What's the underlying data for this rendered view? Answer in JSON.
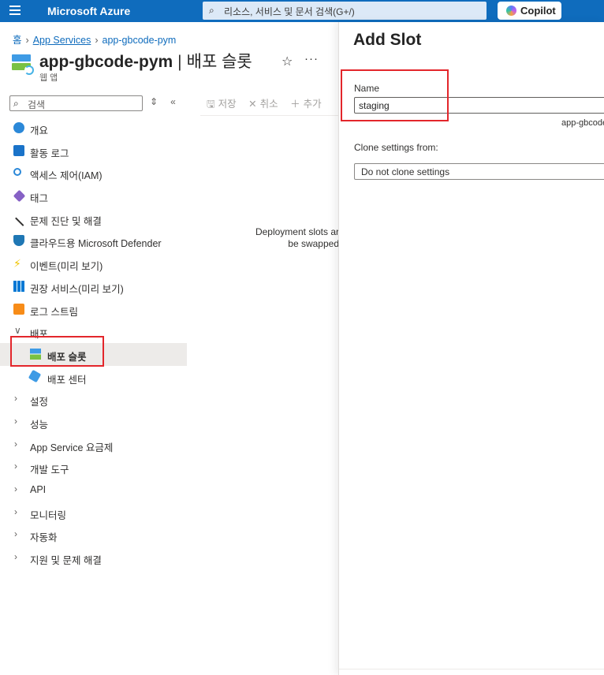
{
  "topbar": {
    "brand": "Microsoft Azure",
    "search_placeholder": "리소스, 서비스 및 문서 검색(G+/)",
    "copilot_label": "Copilot",
    "accent_color": "#0f6cbd"
  },
  "breadcrumb": {
    "home": "홈",
    "app_services": "App Services",
    "resource": "app-gbcode-pym"
  },
  "resource": {
    "name": "app-gbcode-pym",
    "page": "배포 슬롯",
    "type": "웹 앱"
  },
  "menu": {
    "search_placeholder": "검색",
    "items": [
      {
        "label": "개요",
        "icon": "overview-icon"
      },
      {
        "label": "활동 로그",
        "icon": "activity-log-icon"
      },
      {
        "label": "액세스 제어(IAM)",
        "icon": "iam-icon"
      },
      {
        "label": "태그",
        "icon": "tag-icon"
      },
      {
        "label": "문제 진단 및 해결",
        "icon": "wrench-icon"
      },
      {
        "label": "클라우드용 Microsoft Defender",
        "icon": "defender-shield-icon"
      },
      {
        "label": "이벤트(미리 보기)",
        "icon": "lightning-icon"
      },
      {
        "label": "권장 서비스(미리 보기)",
        "icon": "grid-icon"
      },
      {
        "label": "로그 스트림",
        "icon": "log-stream-icon"
      }
    ],
    "deploy_group": "배포",
    "deploy_children": [
      {
        "label": "배포 슬롯",
        "icon": "deployment-slot-icon"
      },
      {
        "label": "배포 센터",
        "icon": "cube-icon"
      }
    ],
    "groups": [
      "설정",
      "성능",
      "App Service 요금제",
      "개발 도구",
      "API",
      "모니터링",
      "자동화",
      "지원 및 문제 해결"
    ]
  },
  "toolbar": {
    "save": "저장",
    "cancel": "취소",
    "add": "추가"
  },
  "empty_message": {
    "line1": "Deployment slots ar",
    "line2": "be swapped"
  },
  "panel": {
    "title": "Add Slot",
    "name_label": "Name",
    "name_value": "staging",
    "name_suffix": "app-gbcode",
    "clone_label": "Clone settings from:",
    "clone_value": "Do not clone settings"
  },
  "highlight_color": "#e3262b"
}
